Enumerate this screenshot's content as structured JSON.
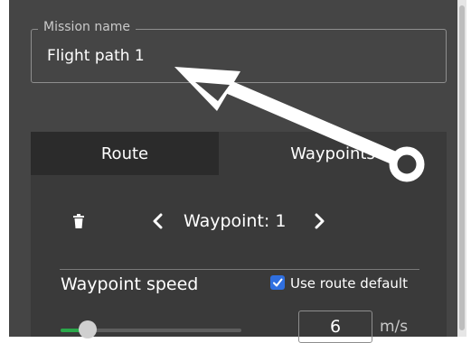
{
  "mission": {
    "label": "Mission name",
    "value": "Flight path 1"
  },
  "tabs": [
    {
      "label": "Route",
      "active": false
    },
    {
      "label": "Waypoints",
      "active": true
    }
  ],
  "waypoint": {
    "label": "Waypoint: 1",
    "speed_label": "Waypoint speed",
    "use_default_label": "Use route default",
    "use_default_checked": true,
    "speed_value": "6",
    "speed_unit": "m/s",
    "slider_level": 0.15
  },
  "icons": {
    "delete": "trash-icon",
    "prev": "chevron-left-icon",
    "next": "chevron-right-icon",
    "annotation": "white-arrow-annotation"
  },
  "colors": {
    "panel": "#454545",
    "tab_inactive": "#2b2b2b",
    "tab_active": "#3a3a3a",
    "checkbox": "#2f6fe0",
    "slider_fill": "#2aa84a"
  }
}
